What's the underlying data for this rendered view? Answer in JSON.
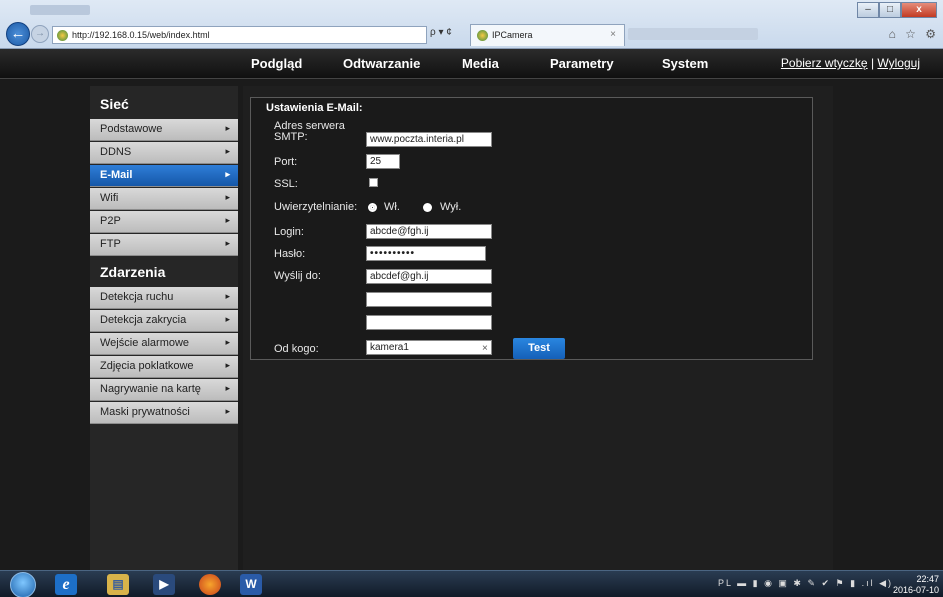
{
  "browser": {
    "url": "http://192.168.0.15/web/index.html",
    "tab_title": "IPCamera",
    "tab_close": "×",
    "back": "←",
    "forward": "→",
    "addr_icons": "ρ ▾ ¢",
    "win_minimize": "–",
    "win_maximize": "□",
    "win_close": "x",
    "right_icons": "⌂ ☆ ⚙"
  },
  "nav": {
    "items": [
      "Podgląd",
      "Odtwarzanie",
      "Media",
      "Parametry",
      "System"
    ],
    "download_link": "Pobierz wtyczkę",
    "separator": "|",
    "logout_link": "Wyloguj"
  },
  "sidebar": {
    "section1_title": "Sieć",
    "section1_items": [
      "Podstawowe",
      "DDNS",
      "E-Mail",
      "Wifi",
      "P2P",
      "FTP"
    ],
    "active_item": "E-Mail",
    "section2_title": "Zdarzenia",
    "section2_items": [
      "Detekcja ruchu",
      "Detekcja zakrycia",
      "Wejście alarmowe",
      "Zdjęcia poklatkowe",
      "Nagrywanie na kartę",
      "Maski prywatności"
    ],
    "chevron": "▸"
  },
  "form": {
    "title": "Ustawienia E-Mail:",
    "smtp_label_line1": "Adres serwera",
    "smtp_label_line2": "SMTP:",
    "smtp_value": "www.poczta.interia.pl",
    "port_label": "Port:",
    "port_value": "25",
    "ssl_label": "SSL:",
    "ssl_checked": false,
    "auth_label": "Uwierzytelnianie:",
    "auth_on_label": "Wł.",
    "auth_off_label": "Wył.",
    "auth_selected": "Wł.",
    "login_label": "Login:",
    "login_value": "abcde@fgh.ij",
    "password_label": "Hasło:",
    "password_value": "••••••••••",
    "send_to_label": "Wyślij do:",
    "send_to_1": "abcdef@gh.ij",
    "send_to_2": "",
    "send_to_3": "",
    "from_label": "Od kogo:",
    "from_value": "kamera1",
    "clear_icon": "×",
    "test_button": "Test"
  },
  "taskbar": {
    "ie_label": "e",
    "explorer_label": "▤",
    "media_label": "▶",
    "word_label": "W",
    "tray_text": "PL ▬ ▮ ◉ ▣ ✱ ✎ ✔ ⚑ ▮ .ıl ◀)",
    "time": "22:47",
    "date": "2016-07-10"
  },
  "colors": {
    "accent": "#1f6cc6",
    "nav_bg": "#1a1a1a",
    "sidebar_item_bg": "#c9c9c9"
  }
}
